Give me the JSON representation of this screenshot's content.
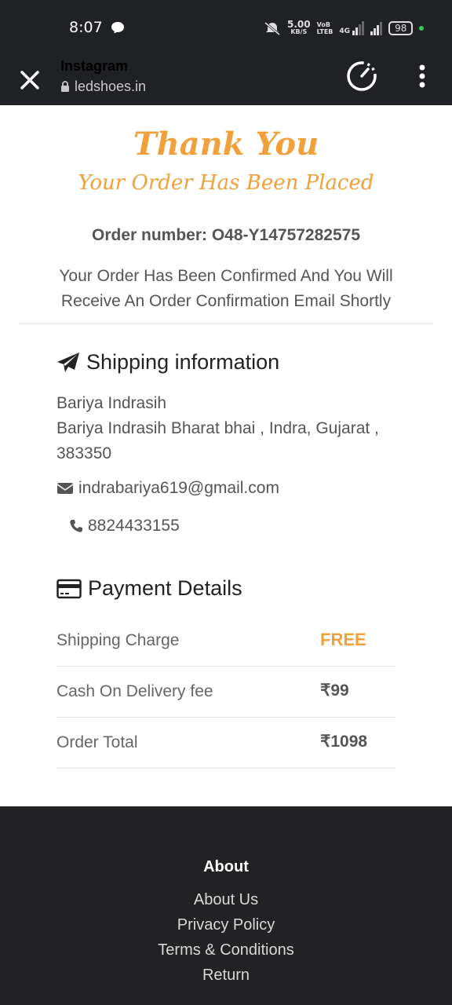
{
  "status": {
    "time": "8:07",
    "speed": "5.00",
    "speed_unit": "KB/S",
    "volte": "VoB\nLTEB",
    "network": "4G",
    "battery": "98"
  },
  "toolbar": {
    "title": "Instagram",
    "url": "ledshoes.in"
  },
  "header": {
    "thank_you": "Thank You",
    "subtitle": "Your Order Has Been Placed",
    "order_number": "Order number: O48-Y14757282575",
    "confirmation": "Your Order Has Been Confirmed And You Will Receive An Order Confirmation Email Shortly"
  },
  "shipping": {
    "title": "Shipping information",
    "name": "Bariya Indrasih",
    "address": "Bariya Indrasih Bharat bhai , Indra, Gujarat , 383350",
    "email": "indrabariya619@gmail.com",
    "phone": "8824433155"
  },
  "payment": {
    "title": "Payment Details",
    "rows": [
      {
        "label": "Shipping Charge",
        "value": "FREE"
      },
      {
        "label": "Cash On Delivery fee",
        "value": "₹99"
      },
      {
        "label": "Order Total",
        "value": "₹1098"
      }
    ]
  },
  "footer": {
    "heading": "About",
    "links": [
      "About Us",
      "Privacy Policy",
      "Terms & Conditions",
      "Return"
    ]
  },
  "colors": {
    "accent": "#f0a13b",
    "dark": "#202124"
  }
}
